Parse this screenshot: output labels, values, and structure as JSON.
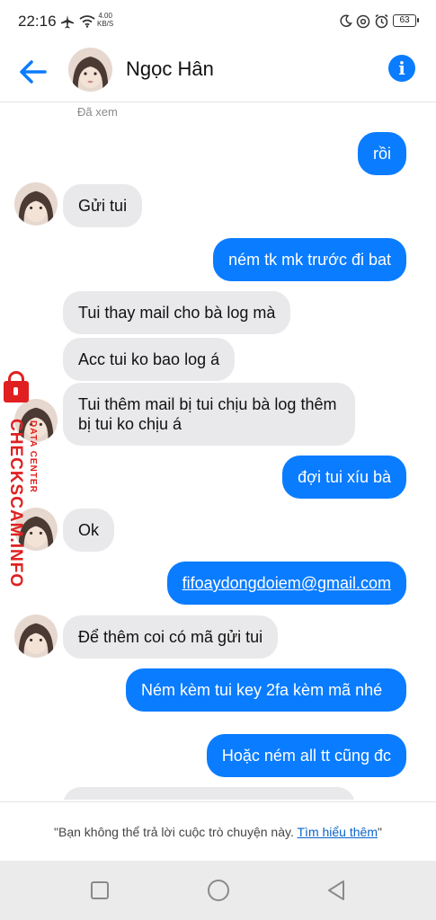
{
  "status_bar": {
    "time": "22:16",
    "net_speed_value": "4.00",
    "net_speed_unit": "KB/S",
    "battery": "63",
    "icons": [
      "airplane-icon",
      "wifi-icon",
      "moon-icon",
      "at-icon",
      "alarm-icon",
      "battery-icon"
    ]
  },
  "header": {
    "contact_name": "Ngọc Hân",
    "icons": [
      "back-arrow-icon",
      "info-icon"
    ],
    "accent_color": "#0a7cff"
  },
  "conversation": {
    "seen_label": "Đã xem",
    "messages": [
      {
        "sender": "me",
        "text": "rồi"
      },
      {
        "sender": "contact",
        "text": "Gửi tui"
      },
      {
        "sender": "me",
        "text": "ném tk mk trước đi bat"
      },
      {
        "sender": "contact",
        "text": "Tui thay mail cho bà log mà"
      },
      {
        "sender": "contact",
        "text": "Acc tui ko bao log á"
      },
      {
        "sender": "contact",
        "text": "Tui thêm mail bị tui chịu bà log thêm bị tui ko chịu á"
      },
      {
        "sender": "me",
        "text": "đợi tui xíu bà"
      },
      {
        "sender": "contact",
        "text": "Ok"
      },
      {
        "sender": "me",
        "text": "fifoaydongdoiem@gmail.com"
      },
      {
        "sender": "contact",
        "text": "Để thêm coi có mã gửi tui"
      },
      {
        "sender": "me",
        "text": "Ném kèm tui key 2fa kèm mã nhé"
      },
      {
        "sender": "me",
        "text": "Hoặc ném all tt cũng đc"
      }
    ]
  },
  "watermark": {
    "brand": "CHECKSCAM.INFO",
    "sub": "DATA CENTER"
  },
  "footer": {
    "notice": "\"Bạn không thể trả lời cuộc trò chuyện này.",
    "link_text": "Tìm hiểu thêm",
    "closing_quote": "\""
  },
  "nav_bar": {
    "icons": [
      "recent-apps-icon",
      "home-icon",
      "back-icon"
    ]
  }
}
